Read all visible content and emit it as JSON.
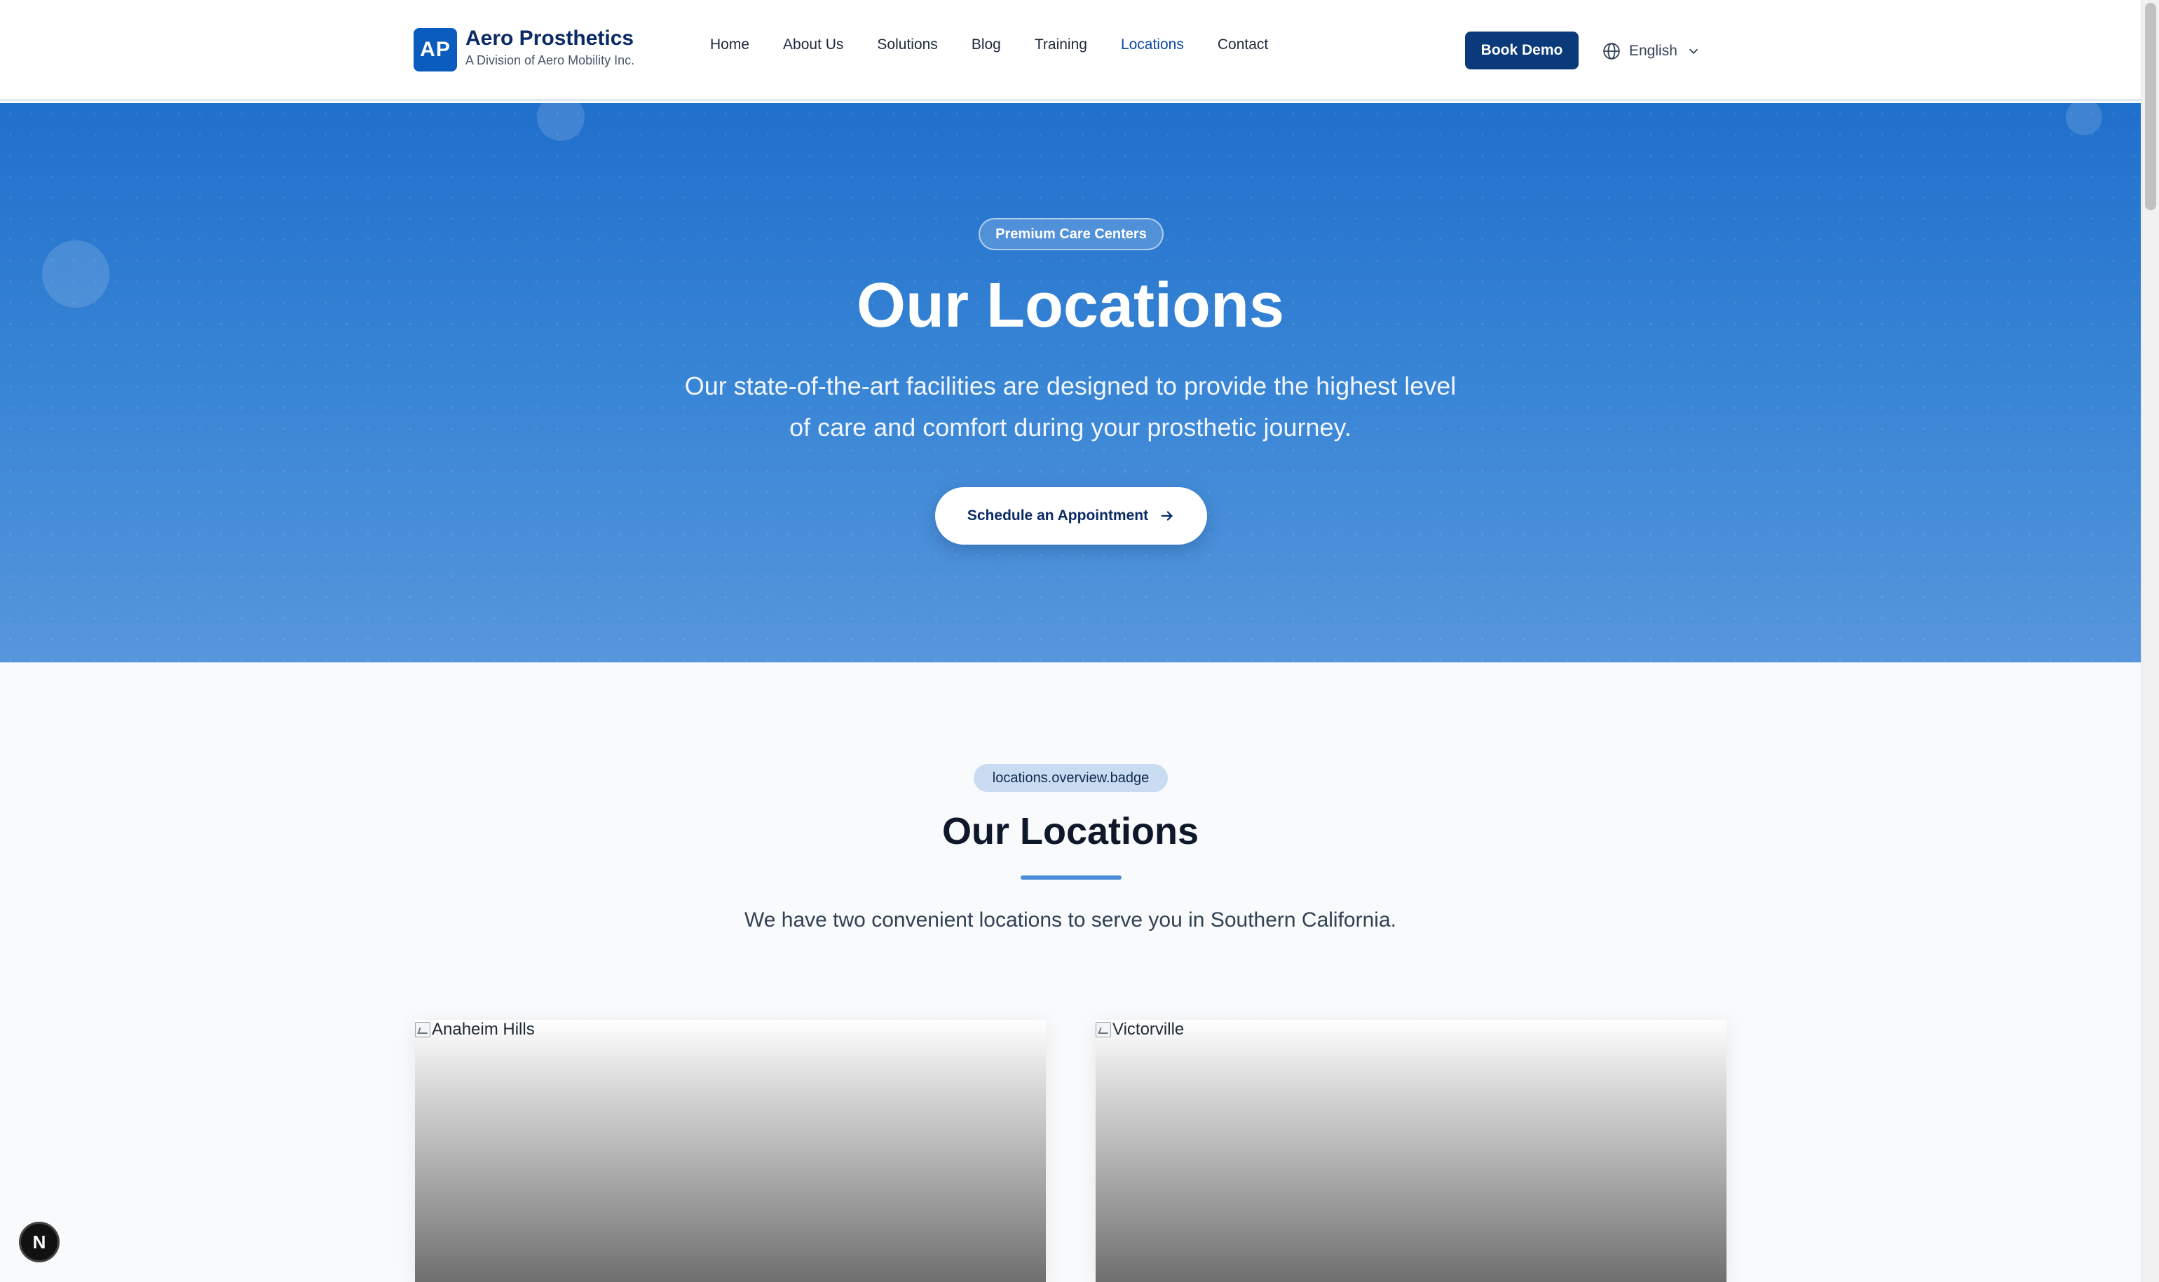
{
  "header": {
    "logo_initials": "AP",
    "brand_name": "Aero Prosthetics",
    "brand_subtitle": "A Division of Aero Mobility Inc.",
    "nav": [
      {
        "label": "Home"
      },
      {
        "label": "About Us"
      },
      {
        "label": "Solutions"
      },
      {
        "label": "Blog"
      },
      {
        "label": "Training"
      },
      {
        "label": "Locations",
        "active": true
      },
      {
        "label": "Contact"
      }
    ],
    "book_demo_label": "Book Demo",
    "language": "English",
    "brand_color": "#0b5cbf",
    "active_nav_color": "#0b4aa2"
  },
  "hero": {
    "badge": "Premium Care Centers",
    "title": "Our Locations",
    "description": "Our state-of-the-art facilities are designed to provide the highest level of care and comfort during your prosthetic journey.",
    "cta_label": "Schedule an Appointment",
    "gradient_top": "#1f6fcc",
    "gradient_bottom": "#5796dc"
  },
  "overview": {
    "badge": "locations.overview.badge",
    "title": "Our Locations",
    "description": "We have two convenient locations to serve you in Southern California."
  },
  "locations": [
    {
      "image_alt": "Anaheim Hills"
    },
    {
      "image_alt": "Victorville"
    }
  ],
  "dev_badge": "N",
  "icons": {
    "globe": "globe-icon",
    "chevron": "chevron-down-icon",
    "arrow": "arrow-right-icon",
    "broken_image": "broken-image-icon"
  }
}
